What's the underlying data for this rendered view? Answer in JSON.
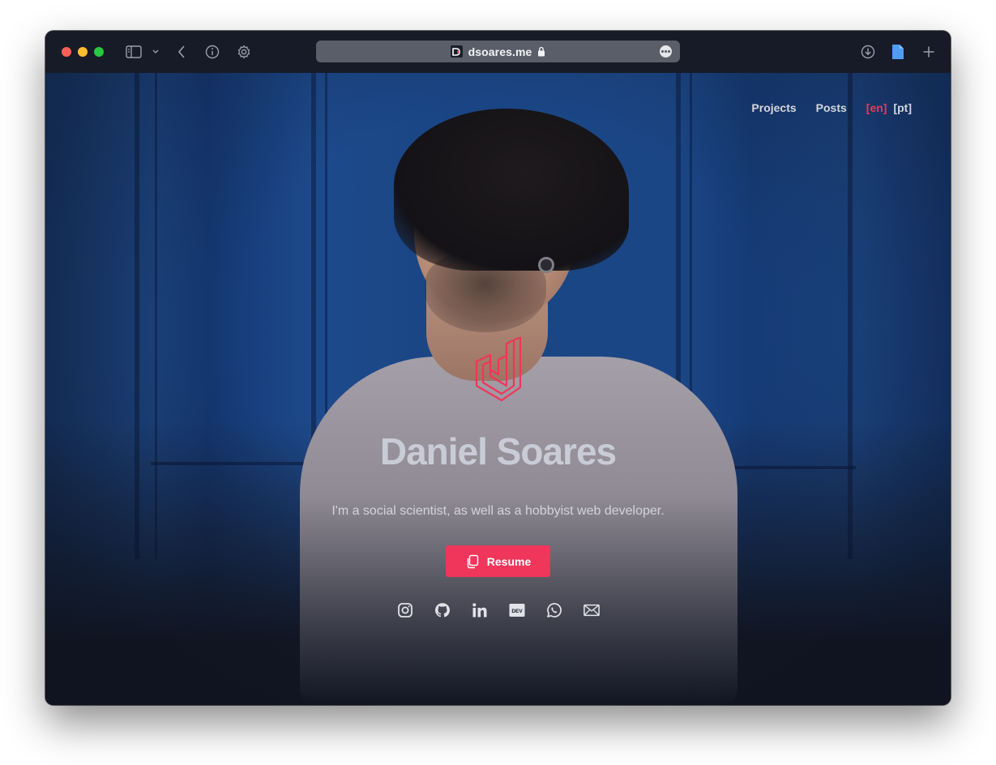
{
  "browser": {
    "url": "dsoares.me",
    "favicon_letter": "D"
  },
  "nav": {
    "projects": "Projects",
    "posts": "Posts",
    "lang_en": "[en]",
    "lang_pt": "[pt]"
  },
  "hero": {
    "name": "Daniel Soares",
    "tagline": "I'm a social scientist, as well as a hobbyist web developer.",
    "resume_label": "Resume"
  },
  "socials": [
    "instagram-icon",
    "github-icon",
    "linkedin-icon",
    "dev-icon",
    "whatsapp-icon",
    "mail-icon"
  ],
  "colors": {
    "accent": "#f0365a",
    "background": "#141824",
    "text": "#c9ccd6"
  }
}
